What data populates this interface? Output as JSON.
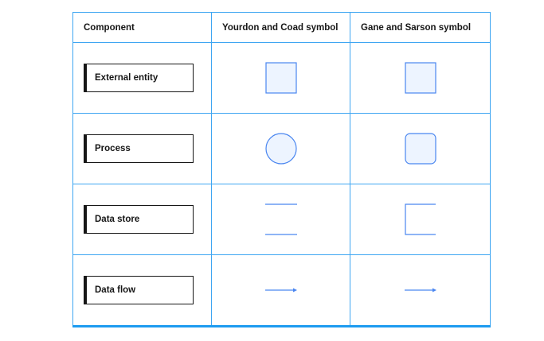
{
  "headers": {
    "component": "Component",
    "yourdon_coad": "Yourdon and Coad symbol",
    "gane_sarson": "Gane and Sarson symbol"
  },
  "rows": [
    {
      "label": "External entity",
      "yourdon_icon": "square-icon",
      "gane_icon": "square-icon"
    },
    {
      "label": "Process",
      "yourdon_icon": "circle-icon",
      "gane_icon": "rounded-square-icon"
    },
    {
      "label": "Data store",
      "yourdon_icon": "parallel-lines-icon",
      "gane_icon": "open-rectangle-icon"
    },
    {
      "label": "Data flow",
      "yourdon_icon": "arrow-right-icon",
      "gane_icon": "arrow-right-icon"
    }
  ],
  "colors": {
    "grid": "#3ea6f2",
    "symbol_stroke": "#4a86f0",
    "symbol_fill": "#edf4ff",
    "text": "#161616"
  }
}
